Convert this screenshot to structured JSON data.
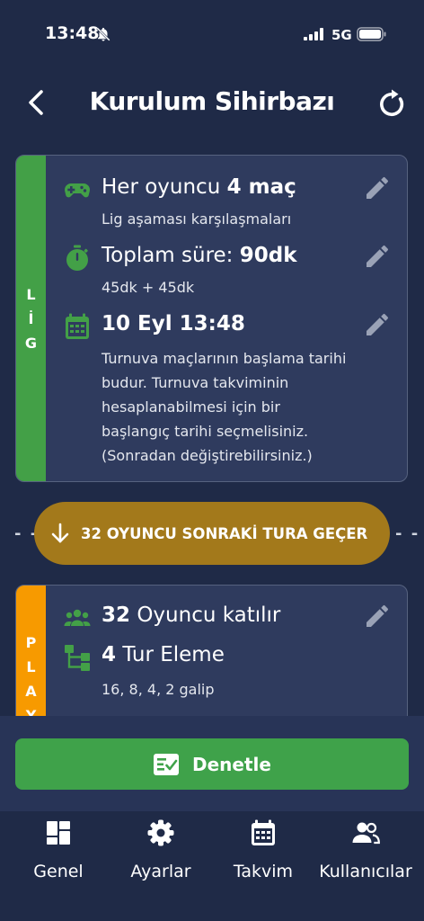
{
  "status": {
    "time": "13:48",
    "network": "5G"
  },
  "header": {
    "title": "Kurulum Sihirbazı"
  },
  "lig_card": {
    "stripe_letters": [
      "L",
      "İ",
      "G"
    ],
    "match": {
      "prefix": "Her oyuncu ",
      "bold": "4 maç",
      "sub": "Lig aşaması karşılaşmaları"
    },
    "duration": {
      "prefix": "Toplam süre: ",
      "bold": "90dk",
      "sub": "45dk + 45dk"
    },
    "date": {
      "bold": "10 Eyl 13:48",
      "sub_lines": [
        "Turnuva maçlarının başlama tarihi",
        "budur. Turnuva takviminin",
        "hesaplanabilmesi için bir",
        "başlangıç tarihi seçmelisiniz.",
        "(Sonradan değiştirebilirsiniz.)"
      ]
    }
  },
  "advance": {
    "label": "32 OYUNCU SONRAKİ TURA GEÇER",
    "dash_left": "- -",
    "dash_right": "- -"
  },
  "play_card": {
    "stripe_letters": [
      "P",
      "L",
      "A",
      "Y"
    ],
    "players": {
      "bold": "32",
      "suffix": " Oyuncu katılır"
    },
    "rounds": {
      "bold": "4",
      "suffix": " Tur Eleme",
      "sub": "16, 8, 4, 2 galip"
    }
  },
  "check_button": {
    "label": "Denetle"
  },
  "tabs": [
    {
      "label": "Genel",
      "icon": "dashboard-icon"
    },
    {
      "label": "Ayarlar",
      "icon": "gear-icon"
    },
    {
      "label": "Takvim",
      "icon": "calendar-icon"
    },
    {
      "label": "Kullanıcılar",
      "icon": "users-icon"
    }
  ],
  "colors": {
    "background": "#1f2a47",
    "card": "#2f3b5e",
    "lig": "#43a047",
    "play": "#f79a00",
    "advance": "#a3791b",
    "button": "#3fa24a"
  }
}
